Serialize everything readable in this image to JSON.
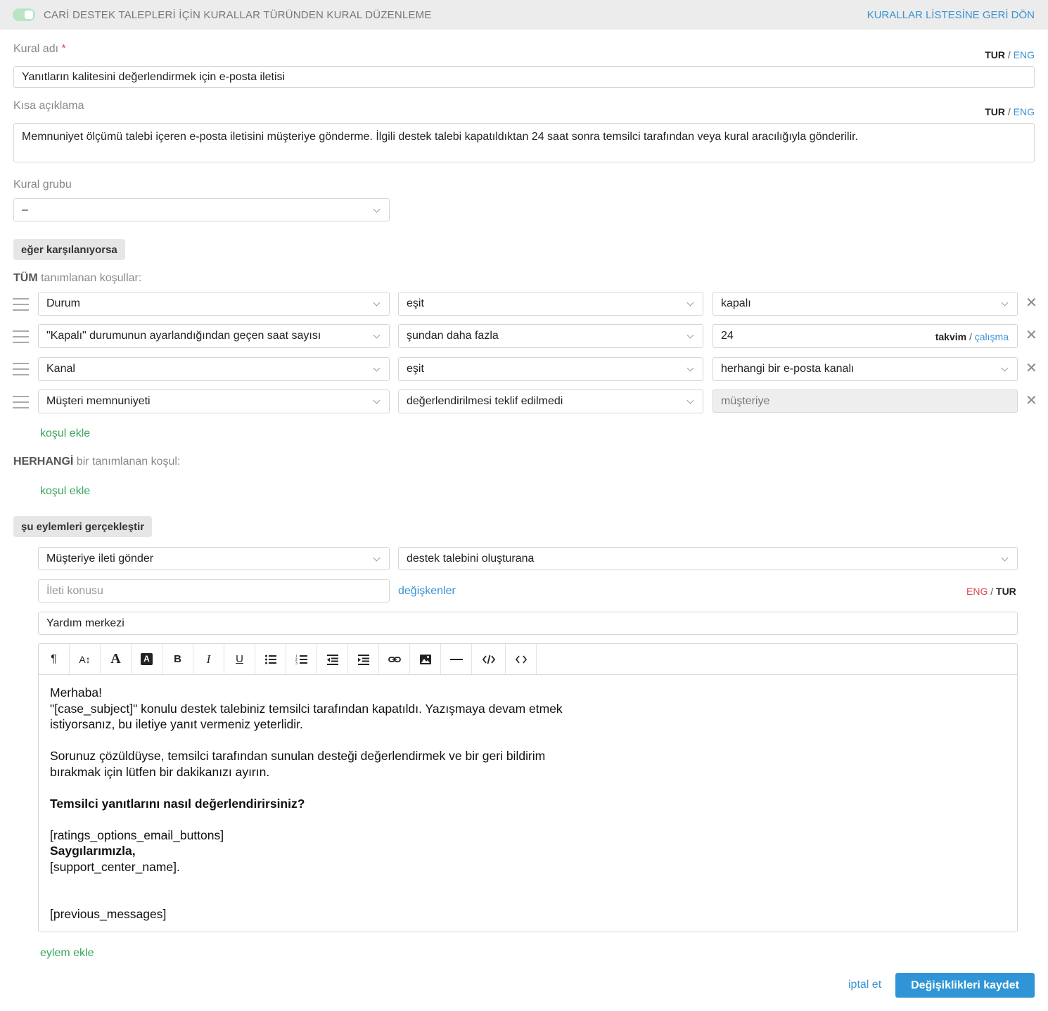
{
  "header": {
    "title": "CARİ DESTEK TALEPLERİ İÇİN KURALLAR TÜRÜNDEN KURAL DÜZENLEME",
    "back_link": "KURALLAR LİSTESİNE GERİ DÖN",
    "enabled": true
  },
  "lang_switch": {
    "tur": "TUR",
    "sep": "/",
    "eng": "ENG"
  },
  "rule_name": {
    "label": "Kural adı",
    "required_mark": "*",
    "value": "Yanıtların kalitesini değerlendirmek için e-posta iletisi"
  },
  "short_description": {
    "label": "Kısa açıklama",
    "value": "Memnuniyet ölçümü talebi içeren e-posta iletisini müşteriye gönderme. İlgili destek talebi kapatıldıktan 24 saat sonra temsilci tarafından veya kural aracılığıyla gönderilir."
  },
  "rule_group": {
    "label": "Kural grubu",
    "value": "–"
  },
  "if_section": {
    "pill": "eğer karşılanıyorsa",
    "all_title_strong": "TÜM",
    "all_title_rest": " tanımlanan koşullar:",
    "conditions": [
      {
        "field": "Durum",
        "operator": "eşit",
        "value": "kapalı"
      },
      {
        "field": "\"Kapalı\" durumunun ayarlandığından geçen saat sayısı",
        "operator": "şundan daha fazla",
        "value": "24",
        "unit_active": "takvim",
        "unit_sep": "/",
        "unit_other": "çalışma"
      },
      {
        "field": "Kanal",
        "operator": "eşit",
        "value": "herhangi bir e-posta kanalı"
      },
      {
        "field": "Müşteri memnuniyeti",
        "operator": "değerlendirilmesi teklif edilmedi",
        "value": "müşteriye"
      }
    ],
    "add_condition": "koşul ekle",
    "any_title_strong": "HERHANGİ",
    "any_title_rest": " bir tanımlanan koşul:",
    "add_condition_any": "koşul ekle"
  },
  "remove_glyph": "✕",
  "actions_section": {
    "pill": "şu eylemleri gerçekleştir",
    "action": "Müşteriye ileti gönder",
    "target": "destek talebini oluşturana",
    "subject_placeholder": "İleti konusu",
    "variables_link": "değişkenler",
    "lang_eng": "ENG",
    "lang_sep": "/",
    "lang_tur": "TUR",
    "sender_value": "Yardım merkezi",
    "toolbar_icons": [
      "paragraph-icon",
      "font-size-icon",
      "font-color-icon",
      "background-color-icon",
      "bold-icon",
      "italic-icon",
      "underline-icon",
      "bullet-list-icon",
      "numbered-list-icon",
      "outdent-icon",
      "indent-icon",
      "link-icon",
      "image-icon",
      "horizontal-rule-icon",
      "code-view-icon",
      "source-icon"
    ],
    "message": {
      "line1": "Merhaba!",
      "line2": "\"[case_subject]\" konulu destek talebiniz temsilci tarafından kapatıldı. Yazışmaya devam etmek",
      "line3": "istiyorsanız, bu iletiye yanıt vermeniz yeterlidir.",
      "line4": "Sorunuz çözüldüyse, temsilci tarafından sunulan desteği değerlendirmek ve bir geri bildirim",
      "line5": "bırakmak için lütfen bir dakikanızı ayırın.",
      "line6": "Temsilci yanıtlarını nasıl değerlendirirsiniz?",
      "line7": "[ratings_options_email_buttons]",
      "line8": "Saygılarımızla,",
      "line9": "[support_center_name].",
      "line10": "[previous_messages]"
    },
    "add_action": "eylem ekle"
  },
  "footer": {
    "cancel": "iptal et",
    "save": "Değişiklikleri kaydet"
  },
  "colors": {
    "accent_blue": "#3b93d1",
    "green_link": "#3aa55c",
    "save_button": "#2f95d6",
    "required": "#e0454a",
    "toggle_on": "#b8e5c4"
  }
}
